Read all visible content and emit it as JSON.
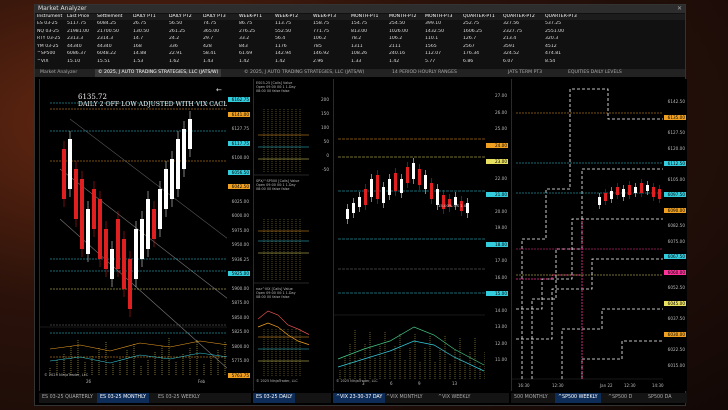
{
  "window": {
    "title": "Market Analyzer"
  },
  "market_table": {
    "columns": [
      "Instrument",
      "Last Price",
      "Settlement",
      "DAILY PT1",
      "DAILY PT2",
      "DAILY PT3",
      "WEEK-PT1",
      "WEEK-PT2",
      "WEEK-PT3",
      "MONTH-PT1",
      "MONTH-PT2",
      "MONTH-PT3",
      "QUARTER-PT1",
      "QUARTER-PT2",
      "QUARTER-PT3"
    ],
    "rows": [
      [
        "ES 03-25",
        "5117.75",
        "6084.25",
        "26.75",
        "56.50",
        "74.75",
        "86.75",
        "113.75",
        "158.75",
        "154.75",
        "254.50",
        "399.10",
        "252.75",
        "327.56",
        "537.25"
      ],
      [
        "NQ 03-25",
        "21981.00",
        "21700.50",
        "130.50",
        "261.25",
        "365.00",
        "276.25",
        "552.50",
        "771.75",
        "813.00",
        "1026.00",
        "1432.50",
        "1606.25",
        "2327.75",
        "2551.00"
      ],
      [
        "RTY 03-25",
        "2313.3",
        "2314.3",
        "14.7",
        "24.2",
        "29.7",
        "33.2",
        "56.4",
        "106.2",
        "78.2",
        "106.2",
        "110.1",
        "126.7",
        "213.4",
        "320.3"
      ],
      [
        "YM 03-25",
        "44340",
        "44340",
        "168",
        "336",
        "428",
        "843",
        "1176",
        "785",
        "1311",
        "2111",
        "1565",
        "2567",
        "3591",
        "4512"
      ],
      [
        "^SP500",
        "6086.37",
        "6048.22",
        "14.88",
        "22.91",
        "58.41",
        "61.69",
        "142.94",
        "146.92",
        "108.26",
        "240.16",
        "112.07",
        "176.34",
        "324.52",
        "474.81"
      ],
      [
        "^VIX",
        "15.10",
        "15.51",
        "1.53",
        "1.62",
        "1.43",
        "1.42",
        "1.42",
        "2.96",
        "1.33",
        "1.42",
        "5.77",
        "6.86",
        "6.07",
        "8.54"
      ]
    ]
  },
  "top_tabs": [
    {
      "label": "Market Analyzer",
      "active": false
    },
    {
      "label": "© 2025, J AUTO TRADING STRATEGIES, LLC (JATS/W)",
      "active": true
    },
    {
      "label": "© 2025, J AUTO TRADING STRATEGIES, LLC (JATS/W)",
      "active": false
    },
    {
      "label": "14 PERIOD HOURLY RANGES",
      "active": false
    },
    {
      "label": "JATS TERM PT3",
      "active": false
    },
    {
      "label": "EQUITIES DAILY LEVELS",
      "active": false
    }
  ],
  "chart1": {
    "price_title": "6135.72",
    "subtitle": "DAILY 2 OFF LOW ADJUSTED WITH VIX CACLS",
    "price_labels": [
      "6162.75",
      "6141.00",
      "6127.75",
      "6117.75",
      "6100.00",
      "6056.50",
      "6042.50",
      "6025.00",
      "6000.00",
      "5975.00",
      "5950.00",
      "5936.25",
      "5925.00",
      "5900.00",
      "5875.00",
      "5850.00",
      "5825.00",
      "5800.00",
      "5775.00",
      "5763.75"
    ],
    "x_labels": [
      "26",
      "Feb"
    ],
    "footer": "© 2025 NinjaTrader, LLC"
  },
  "chart2": {
    "header1": "ES03-25 [Calls] Value Open 09:00 00:1 1.Day 08:00 00 false false",
    "header2": "SPX/^SP500 [Calls] Value Open 09:00 00:1 1.Day 08:00 00 false false",
    "header3": "naz^VIX [Calls] Value Open 09:00 00:1 1.Day 08:00 00 false false",
    "scale": [
      "200",
      "150",
      "100",
      "50",
      "0",
      "-50"
    ],
    "footer": "© 2025 NinjaTrader, LLC"
  },
  "chart3": {
    "price_labels": [
      "27.00",
      "26.00",
      "25.00",
      "24.00",
      "23.00",
      "22.00",
      "21.00",
      "20.00",
      "19.00",
      "18.00",
      "17.00",
      "16.00",
      "15.00",
      "14.00",
      "13.00",
      "12.00",
      "11.00"
    ],
    "mid_text": "15.00% OS 1.0",
    "x_labels": [
      "3",
      "6",
      "9",
      "13"
    ],
    "footer": "© 2025 NinjaTrader, LLC"
  },
  "chart4": {
    "price_labels": [
      "6142.50",
      "6135.00",
      "6127.50",
      "6120.00",
      "6112.50",
      "6105.00",
      "6097.50",
      "6090.00",
      "6082.50",
      "6075.00",
      "6067.50",
      "6060.00",
      "6052.50",
      "6045.00",
      "6037.50",
      "6030.00",
      "6022.50",
      "6015.00"
    ],
    "x_labels": [
      "16:30",
      "12:30",
      "Jan 22",
      "12:30",
      "14:30"
    ]
  },
  "bottom_tabs_1": [
    {
      "label": "ES 03-25 QUARTERLY",
      "active": false
    },
    {
      "label": "ES 03-25 MONTHLY",
      "active": true
    },
    {
      "label": "ES 03-25 WEEKLY",
      "active": false
    }
  ],
  "bottom_tabs_2": [
    {
      "label": "ES 03-25 DAILY",
      "active": true
    }
  ],
  "bottom_tabs_3": [
    {
      "label": "^VIX 23-30-37 DAY",
      "active": true
    },
    {
      "label": "^VIX MONTHLY",
      "active": false
    },
    {
      "label": "^VIX WEEKLY",
      "active": false
    }
  ],
  "bottom_tabs_4": [
    {
      "label": "500 MONTHLY",
      "active": false
    },
    {
      "label": "^SP500 WEEKLY",
      "active": true
    },
    {
      "label": "^SP500 D",
      "active": false
    },
    {
      "label": "SP500 DA",
      "active": false
    }
  ],
  "colors": {
    "up": "#ffffff",
    "down": "#e02020",
    "cyan": "#33ccdd",
    "orange": "#f0a020",
    "yellow": "#e8e060",
    "magenta": "#ff3399",
    "tab_active": "#0d2c57"
  },
  "icons": [
    "close-icon",
    "back-arrow-icon"
  ]
}
